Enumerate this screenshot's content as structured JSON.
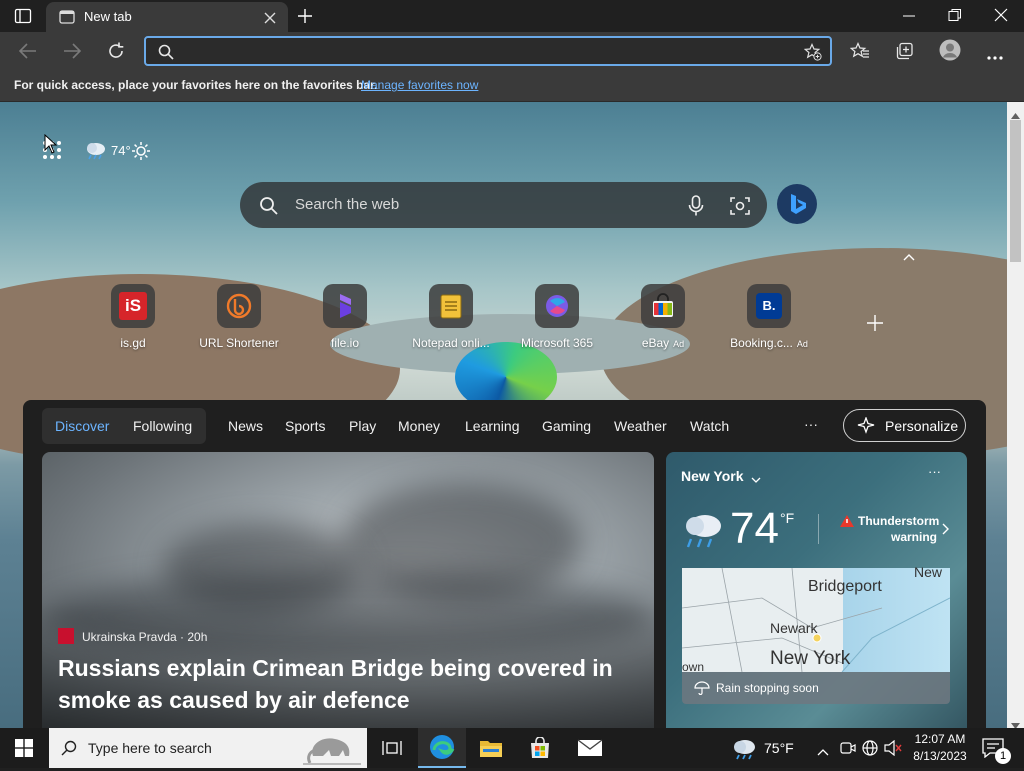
{
  "browser": {
    "tab_title": "New tab",
    "address_value": "",
    "favbar_message": "For quick access, place your favorites here on the favorites bar.",
    "favbar_link": "Manage favorites now"
  },
  "ntp": {
    "weather_temp": "74°",
    "search_placeholder": "Search the web",
    "quick_links": [
      {
        "label": "is.gd",
        "ad": ""
      },
      {
        "label": "URL Shortener",
        "ad": ""
      },
      {
        "label": "file.io",
        "ad": ""
      },
      {
        "label": "Notepad onli...",
        "ad": ""
      },
      {
        "label": "Microsoft 365",
        "ad": ""
      },
      {
        "label": "eBay",
        "ad": "Ad"
      },
      {
        "label": "Booking.c...",
        "ad": "Ad"
      }
    ],
    "quick_link_icon_text": {
      "isgd": "iS",
      "booking": "B."
    }
  },
  "feed": {
    "tabs": [
      "Discover",
      "Following",
      "News",
      "Sports",
      "Play",
      "Money",
      "Learning",
      "Gaming",
      "Weather",
      "Watch"
    ],
    "more": "···",
    "personalize": "Personalize",
    "story": {
      "source": "Ukrainska Pravda · 20h",
      "headline": "Russians explain Crimean Bridge being covered in smoke as caused by air defence"
    },
    "weather": {
      "location": "New York",
      "temp": "74",
      "unit": "°F",
      "alert_line1": "Thunderstorm",
      "alert_line2": "warning",
      "map_labels": [
        "Bridgeport",
        "New",
        "Newark",
        "New York",
        "own"
      ],
      "footer": "Rain stopping soon",
      "more": "···"
    }
  },
  "taskbar": {
    "search_placeholder": "Type here to search",
    "weather": "75°F",
    "time": "12:07 AM",
    "date": "8/13/2023",
    "notification_count": "1"
  },
  "colors": {
    "accent": "#6aa9e8",
    "link": "#6cb4ff",
    "feed_bg": "#1f1f1f",
    "selected_tab": "#6cb4ff"
  }
}
